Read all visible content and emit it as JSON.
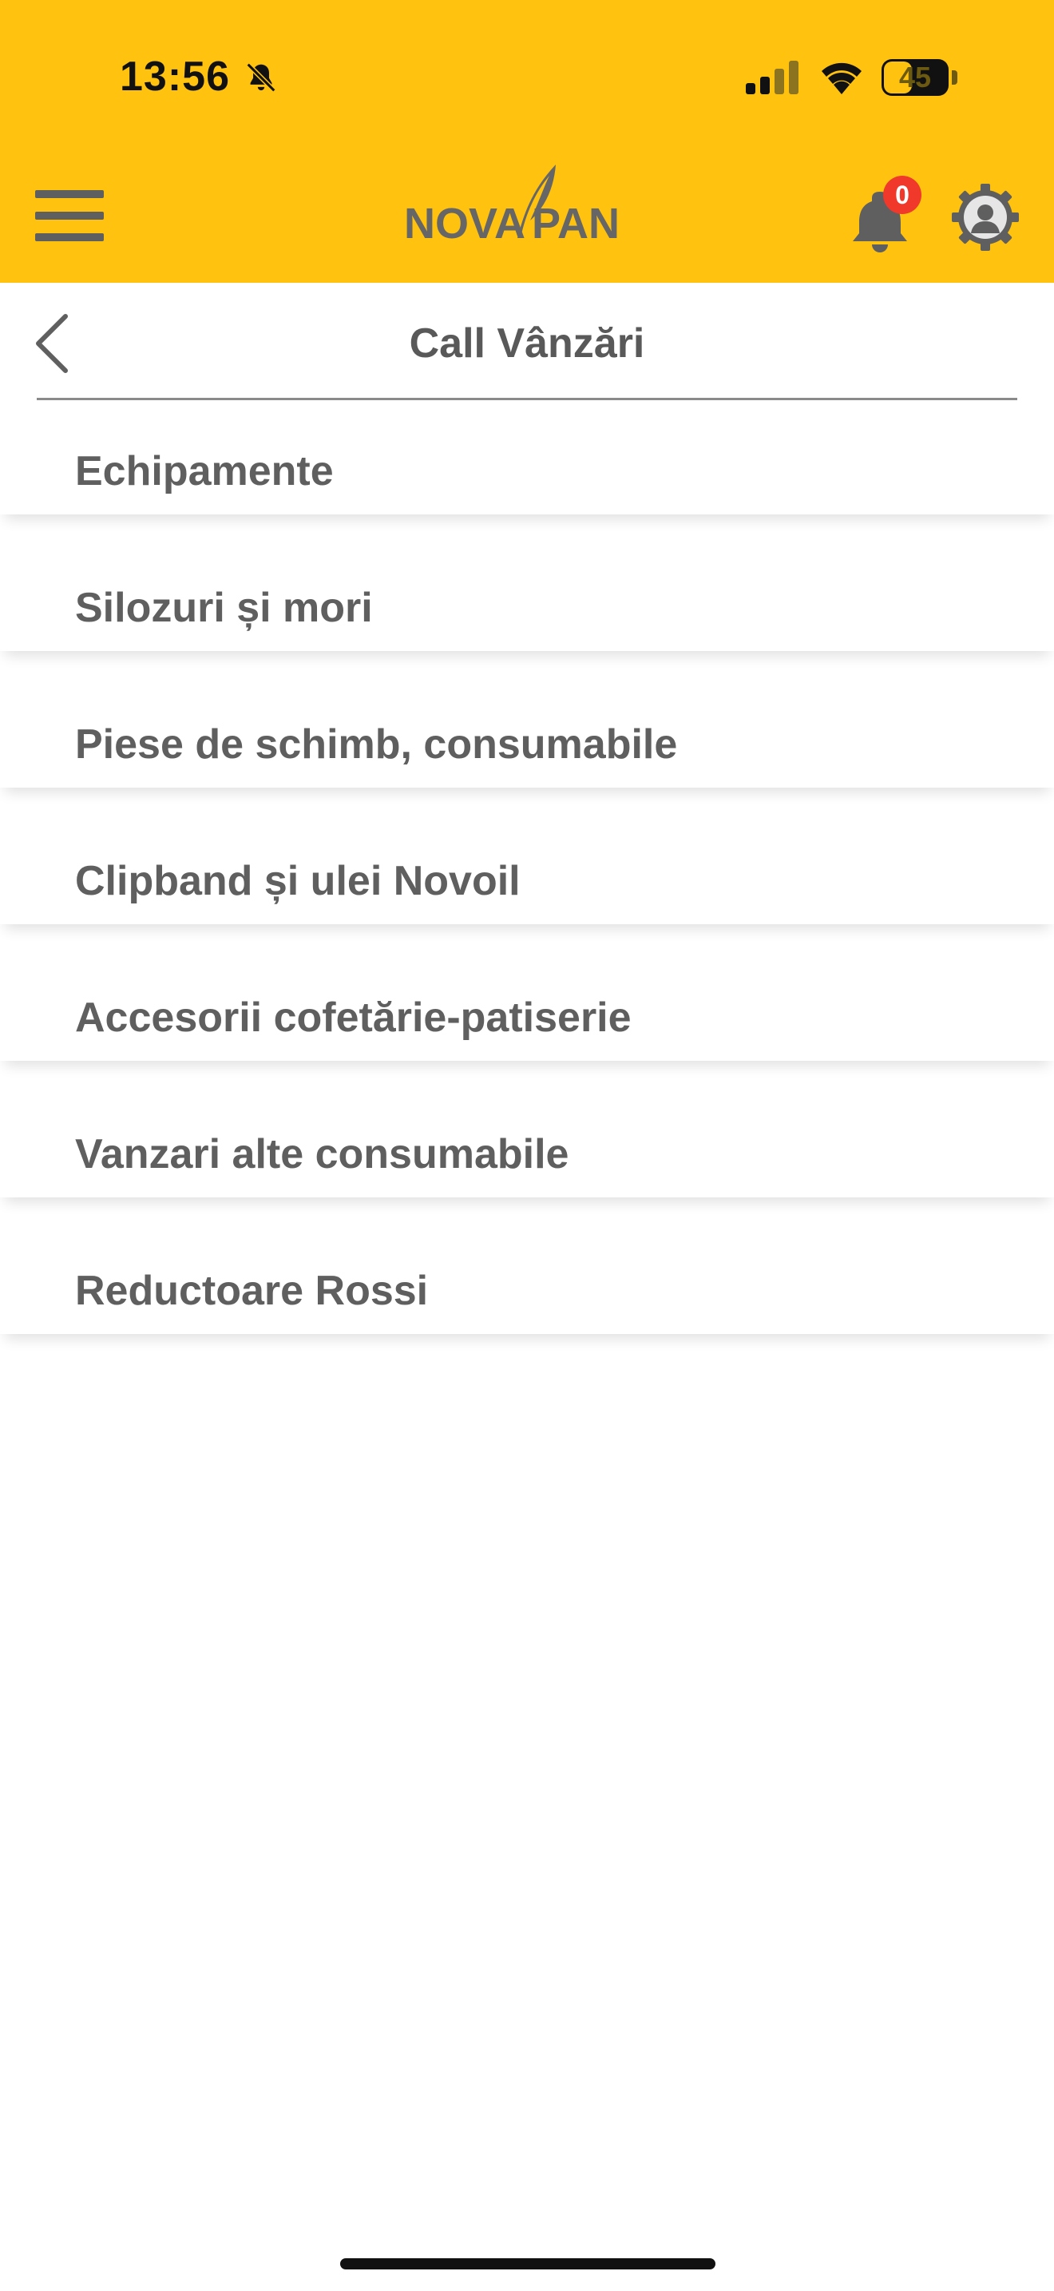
{
  "status_bar": {
    "time": "13:56",
    "battery_level": "45"
  },
  "app_bar": {
    "logo_text_left": "NOVA",
    "logo_text_right": "PAN",
    "notification_count": "0",
    "colors": {
      "header_bg": "#FFC20E",
      "icon_gray": "#5f5f5f",
      "badge_red": "#F0382B"
    }
  },
  "page": {
    "title": "Call Vânzări"
  },
  "list": {
    "items": [
      {
        "label": "Echipamente"
      },
      {
        "label": "Silozuri și mori"
      },
      {
        "label": "Piese de schimb, consumabile"
      },
      {
        "label": "Clipband și ulei Novoil"
      },
      {
        "label": "Accesorii cofetărie-patiserie"
      },
      {
        "label": "Vanzari alte consumabile"
      },
      {
        "label": "Reductoare Rossi"
      }
    ]
  }
}
